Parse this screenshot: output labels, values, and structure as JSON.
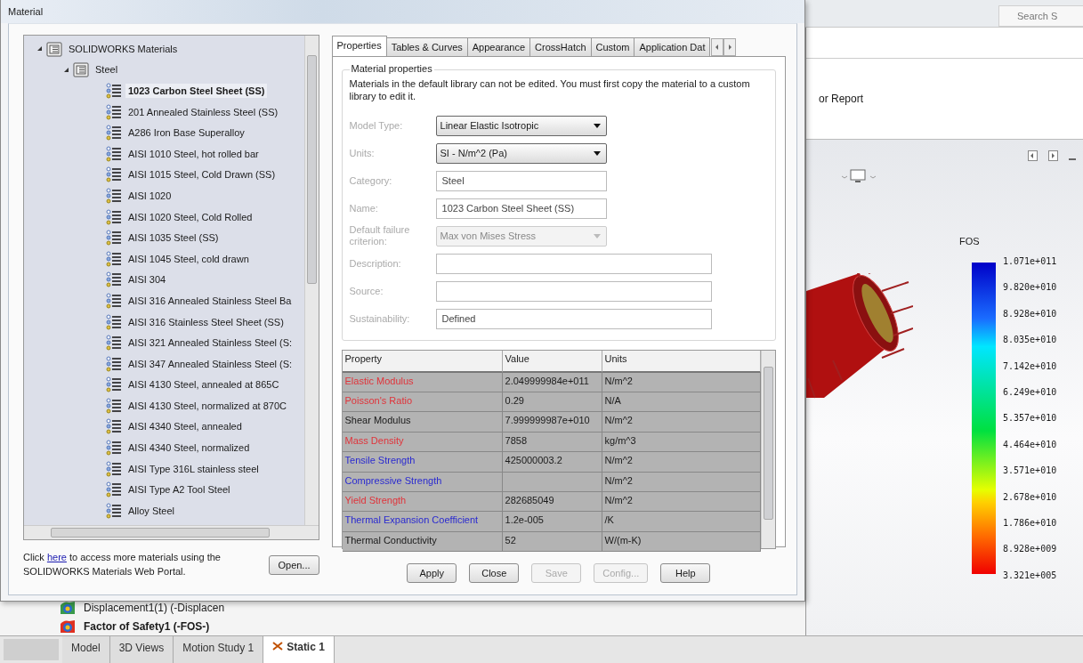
{
  "app": {
    "search": {
      "placeholder": "Search S"
    },
    "ribbon_text": "or Report"
  },
  "legend": {
    "title": "FOS",
    "labels": [
      "1.071e+011",
      "9.820e+010",
      "8.928e+010",
      "8.035e+010",
      "7.142e+010",
      "6.249e+010",
      "5.357e+010",
      "4.464e+010",
      "3.571e+010",
      "2.678e+010",
      "1.786e+010",
      "8.928e+009",
      "3.321e+005"
    ]
  },
  "study_tree": [
    {
      "label": "Displacement1(1) (-Displacen",
      "active": false
    },
    {
      "label": "Factor of Safety1 (-FOS-)",
      "active": true
    }
  ],
  "bottom_tabs": [
    {
      "label": "Model",
      "selected": false
    },
    {
      "label": "3D Views",
      "selected": false
    },
    {
      "label": "Motion Study 1",
      "selected": false
    },
    {
      "label": "Static 1",
      "selected": true
    }
  ],
  "dialog": {
    "title": "Material",
    "tree": {
      "label": "SOLIDWORKS Materials",
      "expanded": true,
      "children": [
        {
          "label": "Steel",
          "expanded": true,
          "children": [
            {
              "label": "1023 Carbon Steel Sheet (SS)",
              "selected": true
            },
            {
              "label": "201 Annealed Stainless Steel (SS)",
              "selected": false
            },
            {
              "label": "A286 Iron Base Superalloy",
              "selected": false
            },
            {
              "label": "AISI 1010 Steel, hot rolled bar",
              "selected": false
            },
            {
              "label": "AISI 1015 Steel, Cold Drawn (SS)",
              "selected": false
            },
            {
              "label": "AISI 1020",
              "selected": false
            },
            {
              "label": "AISI 1020 Steel, Cold Rolled",
              "selected": false
            },
            {
              "label": "AISI 1035 Steel (SS)",
              "selected": false
            },
            {
              "label": "AISI 1045 Steel, cold drawn",
              "selected": false
            },
            {
              "label": "AISI 304",
              "selected": false
            },
            {
              "label": "AISI 316 Annealed Stainless Steel Ba",
              "selected": false
            },
            {
              "label": "AISI 316 Stainless Steel Sheet (SS)",
              "selected": false
            },
            {
              "label": "AISI 321 Annealed Stainless Steel (S:",
              "selected": false
            },
            {
              "label": "AISI 347 Annealed Stainless Steel (S:",
              "selected": false
            },
            {
              "label": "AISI 4130 Steel, annealed at 865C",
              "selected": false
            },
            {
              "label": "AISI 4130 Steel, normalized at 870C",
              "selected": false
            },
            {
              "label": "AISI 4340 Steel, annealed",
              "selected": false
            },
            {
              "label": "AISI 4340 Steel, normalized",
              "selected": false
            },
            {
              "label": "AISI Type 316L stainless steel",
              "selected": false
            },
            {
              "label": "AISI Type A2 Tool Steel",
              "selected": false
            },
            {
              "label": "Alloy Steel",
              "selected": false
            }
          ]
        }
      ]
    },
    "portal_note": {
      "before": "Click ",
      "link": "here",
      "after": " to access more materials using the SOLIDWORKS Materials Web Portal."
    },
    "open_button": "Open...",
    "tabs": [
      {
        "label": "Properties",
        "selected": true
      },
      {
        "label": "Tables & Curves",
        "selected": false
      },
      {
        "label": "Appearance",
        "selected": false
      },
      {
        "label": "CrossHatch",
        "selected": false
      },
      {
        "label": "Custom",
        "selected": false
      },
      {
        "label": "Application Dat",
        "selected": false
      }
    ],
    "group_title": "Material properties",
    "notice": "Materials in the default library can not be edited. You must first copy the material to a custom library to edit it.",
    "fields": [
      {
        "label": "Model Type:",
        "kind": "dropdown",
        "value": "Linear Elastic Isotropic",
        "disabled": false
      },
      {
        "label": "Units:",
        "kind": "dropdown",
        "value": "SI - N/m^2 (Pa)",
        "disabled": false
      },
      {
        "label": "Category:",
        "kind": "text",
        "value": "Steel"
      },
      {
        "label": "Name:",
        "kind": "text",
        "value": "1023 Carbon Steel Sheet (SS)"
      },
      {
        "label": "Default failure criterion:",
        "kind": "dropdown",
        "value": "Max von Mises Stress",
        "disabled": true
      },
      {
        "label": "Description:",
        "kind": "long"
      },
      {
        "label": "Source:",
        "kind": "long"
      },
      {
        "label": "Sustainability:",
        "kind": "long",
        "value": "Defined"
      }
    ],
    "table": {
      "columns": [
        "Property",
        "Value",
        "Units"
      ],
      "rows": [
        {
          "property": "Elastic Modulus",
          "value": "2.049999984e+011",
          "units": "N/m^2",
          "color": "#e0333a"
        },
        {
          "property": "Poisson's Ratio",
          "value": "0.29",
          "units": "N/A",
          "color": "#e0333a"
        },
        {
          "property": "Shear Modulus",
          "value": "7.999999987e+010",
          "units": "N/m^2",
          "color": "#1a1a1a"
        },
        {
          "property": "Mass Density",
          "value": "7858",
          "units": "kg/m^3",
          "color": "#e0333a"
        },
        {
          "property": "Tensile Strength",
          "value": "425000003.2",
          "units": "N/m^2",
          "color": "#2a2ad0"
        },
        {
          "property": "Compressive Strength",
          "units": "N/m^2",
          "color": "#2a2ad0"
        },
        {
          "property": "Yield Strength",
          "value": "282685049",
          "units": "N/m^2",
          "color": "#e0333a"
        },
        {
          "property": "Thermal Expansion Coefficient",
          "value": "1.2e-005",
          "units": "/K",
          "color": "#2a2ad0"
        },
        {
          "property": "Thermal Conductivity",
          "value": "52",
          "units": "W/(m-K)",
          "color": "#1a1a1a"
        }
      ]
    },
    "buttons": [
      {
        "label": "Apply",
        "disabled": false
      },
      {
        "label": "Close",
        "disabled": false
      },
      {
        "label": "Save",
        "disabled": true
      },
      {
        "label": "Config...",
        "disabled": true
      },
      {
        "label": "Help",
        "disabled": false
      }
    ]
  }
}
